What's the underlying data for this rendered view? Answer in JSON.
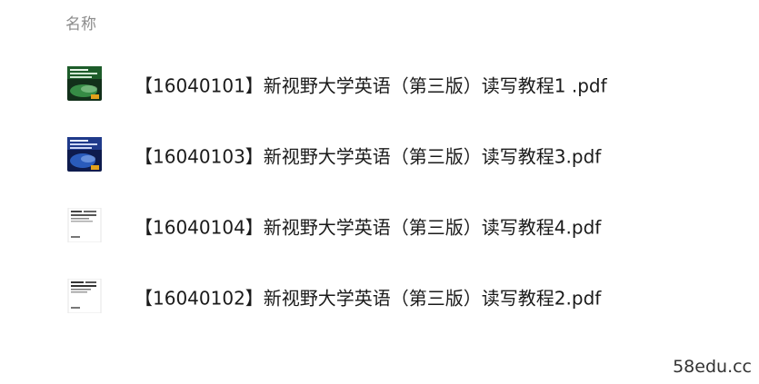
{
  "header": {
    "column_name": "名称"
  },
  "files": [
    {
      "name": "【16040101】新视野大学英语（第三版）读写教程1 .pdf",
      "thumbnail": "book-cover-green-icon"
    },
    {
      "name": "【16040103】新视野大学英语（第三版）读写教程3.pdf",
      "thumbnail": "book-cover-blue-icon"
    },
    {
      "name": "【16040104】新视野大学英语（第三版）读写教程4.pdf",
      "thumbnail": "document-page-icon"
    },
    {
      "name": "【16040102】新视野大学英语（第三版）读写教程2.pdf",
      "thumbnail": "document-page-icon"
    }
  ],
  "watermark": "58edu.cc",
  "colors": {
    "header_text": "#8c8c8c",
    "file_text": "#1a1a1a",
    "cover_green": "#2f7d3a",
    "cover_blue": "#1f3a8a"
  }
}
